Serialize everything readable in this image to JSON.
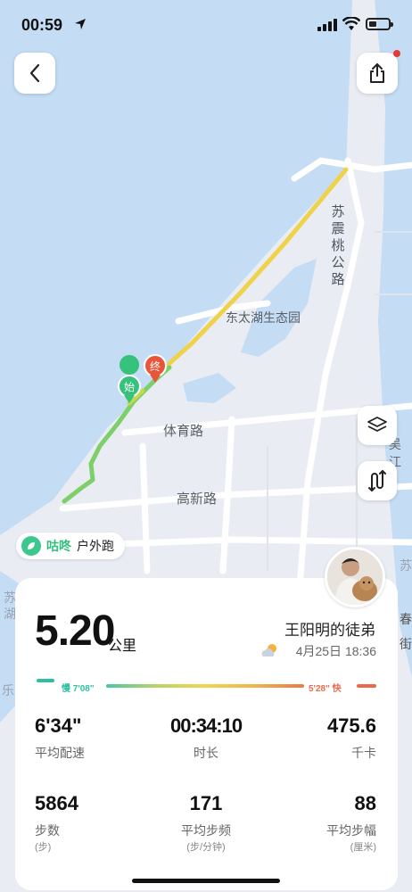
{
  "status": {
    "time": "00:59"
  },
  "map": {
    "area_label": "东太湖生态园",
    "road_tiyu": "体育路",
    "road_gaoxin": "高新路",
    "road_suzhen": "苏震桃公路",
    "edge_wujiang": "吴江",
    "edge_su": "苏",
    "edge_su2": "苏",
    "edge_hu": "湖",
    "edge_le": "乐",
    "edge_chun": "春",
    "edge_jie": "街",
    "start_marker": "始",
    "end_marker": "终"
  },
  "brand": {
    "name": "咕咚",
    "activity": "户外跑"
  },
  "summary": {
    "distance": "5.20",
    "distance_unit": "公里",
    "username": "王阳明的徒弟",
    "datetime": "4月25日 18:36",
    "pace_slow": "慢 7'08\"",
    "pace_fast": "5'28\" 快"
  },
  "stats": [
    {
      "value": "6'34\"",
      "label": "平均配速"
    },
    {
      "value": "00:34:10",
      "label": "时长"
    },
    {
      "value": "475.6",
      "label": "千卡"
    },
    {
      "value": "5864",
      "label": "步数",
      "sub": "(步)"
    },
    {
      "value": "171",
      "label": "平均步频",
      "sub": "(步/分钟)"
    },
    {
      "value": "88",
      "label": "平均步幅",
      "sub": "(厘米)"
    }
  ],
  "colors": {
    "water": "#c4dcf4",
    "land": "#e9edf3",
    "accent_green": "#2fbf7b",
    "route_yellow": "#f0d24a"
  }
}
